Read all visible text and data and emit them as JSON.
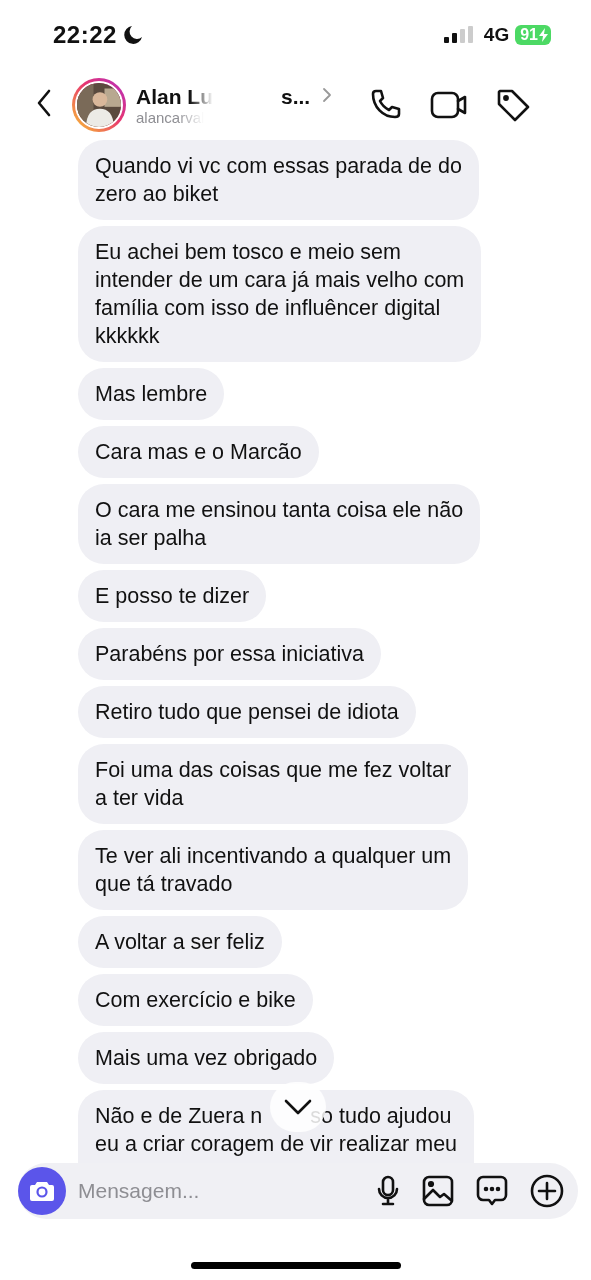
{
  "status_bar": {
    "time": "22:22",
    "network": "4G",
    "battery": "91"
  },
  "header": {
    "name_start": "Alan Lu",
    "name_end": "s...",
    "username": "alancarval"
  },
  "messages": [
    {
      "kind": "text",
      "lines": [
        "Quando vi vc com essas parada de do",
        "zero ao biket"
      ]
    },
    {
      "kind": "text",
      "lines": [
        "Eu achei bem tosco e meio sem",
        "intender de um cara já mais velho com",
        "família com isso de influêncer digital",
        "kkkkkk"
      ]
    },
    {
      "kind": "text",
      "lines": [
        "Mas lembre"
      ]
    },
    {
      "kind": "text",
      "lines": [
        "Cara mas e o Marcão"
      ]
    },
    {
      "kind": "text",
      "lines": [
        "O cara me ensinou tanta coisa ele não",
        "ia ser palha"
      ]
    },
    {
      "kind": "text",
      "lines": [
        "E posso te dizer"
      ]
    },
    {
      "kind": "text",
      "lines": [
        "Parabéns por essa iniciativa"
      ]
    },
    {
      "kind": "text",
      "lines": [
        "Retiro tudo que pensei de idiota"
      ]
    },
    {
      "kind": "text",
      "lines": [
        "Foi uma das coisas que me fez voltar",
        "a ter vida"
      ]
    },
    {
      "kind": "text",
      "lines": [
        "Te ver ali incentivando a qualquer um",
        "que tá travado"
      ]
    },
    {
      "kind": "text",
      "lines": [
        "A voltar a ser feliz"
      ]
    },
    {
      "kind": "text",
      "lines": [
        "Com exercício e bike"
      ]
    },
    {
      "kind": "text",
      "lines": [
        "Mais uma vez obrigado"
      ]
    },
    {
      "kind": "covered",
      "segments": [
        "Não e de Zuera n",
        "so tudo ajudou"
      ],
      "lines": [
        "eu a criar coragem de vir realizar meu"
      ]
    }
  ],
  "composer": {
    "placeholder": "Mensagem..."
  }
}
